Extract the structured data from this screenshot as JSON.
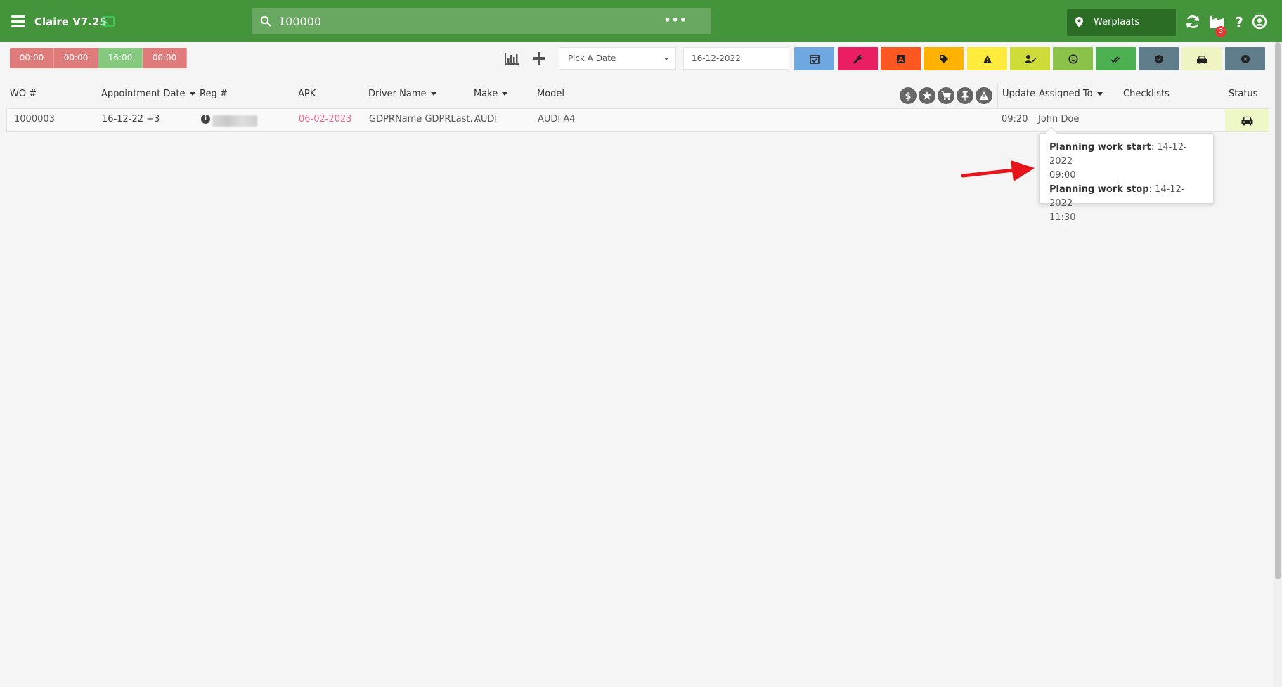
{
  "header": {
    "app_title": "Claire V7.25",
    "search_value": "100000",
    "search_more": "•••",
    "location": "Werplaats",
    "notification_count": "3"
  },
  "toolbar": {
    "timers": [
      {
        "label": "00:00",
        "color": "#e07b7b"
      },
      {
        "label": "00:00",
        "color": "#e07b7b"
      },
      {
        "label": "16:00",
        "color": "#84c97e"
      },
      {
        "label": "00:00",
        "color": "#e07b7b"
      }
    ],
    "date_picker_placeholder": "Pick A Date",
    "date_value": "16-12-2022",
    "filters": [
      {
        "icon": "calendar-check-icon",
        "color": "#6fa8e0"
      },
      {
        "icon": "wrench-icon",
        "color": "#e91e63"
      },
      {
        "icon": "letter-a-icon",
        "color": "#ff5722"
      },
      {
        "icon": "tag-icon",
        "color": "#ffb300"
      },
      {
        "icon": "warning-icon",
        "color": "#ffeb3b"
      },
      {
        "icon": "user-check-icon",
        "color": "#cddc39"
      },
      {
        "icon": "smile-icon",
        "color": "#8bc34a"
      },
      {
        "icon": "double-check-icon",
        "color": "#4caf50"
      },
      {
        "icon": "shield-check-icon",
        "color": "#607d8b"
      },
      {
        "icon": "car-icon",
        "color": "#f0f4c3"
      },
      {
        "icon": "close-circle-icon",
        "color": "#607d8b"
      }
    ]
  },
  "table": {
    "headers": {
      "wo": "WO #",
      "appointment_date": "Appointment Date",
      "reg": "Reg #",
      "apk": "APK",
      "driver_name": "Driver Name",
      "make": "Make",
      "model": "Model",
      "update": "Update",
      "assigned_to": "Assigned To",
      "checklists": "Checklists",
      "status": "Status"
    },
    "header_icons": [
      "dollar-icon",
      "star-icon",
      "cart-icon",
      "pin-icon",
      "warning-icon"
    ],
    "rows": [
      {
        "wo": "1000003",
        "appointment_date": "16-12-22 +3",
        "apk": "06-02-2023",
        "driver_name": "GDPRName GDPRLast…",
        "make": "AUDI",
        "model": "AUDI A4",
        "update": "09:20",
        "assigned_to": "John Doe",
        "status_icon": "car-icon"
      }
    ]
  },
  "tooltip": {
    "start_label": "Planning work start",
    "start_value": ": 14-12-2022",
    "start_time": "09:00",
    "stop_label": "Planning work stop",
    "stop_value": ": 14-12-2022",
    "stop_time": "11:30"
  }
}
